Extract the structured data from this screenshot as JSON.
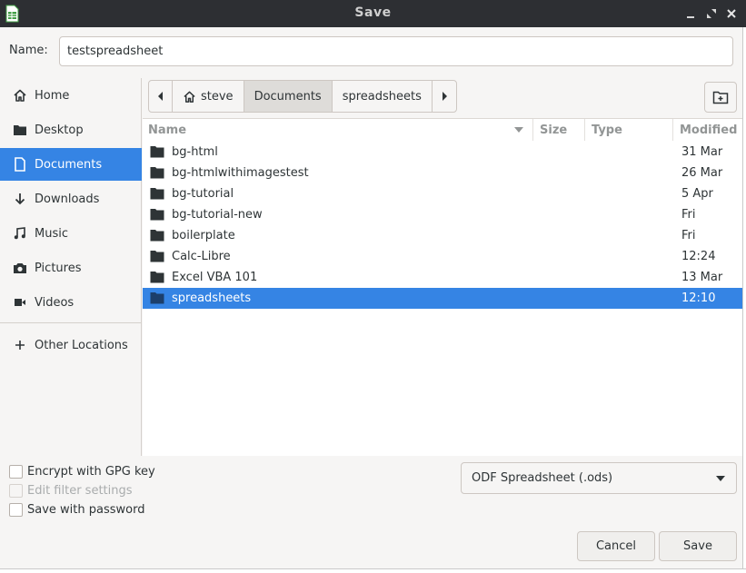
{
  "window": {
    "title": "Save"
  },
  "name_field": {
    "label": "Name:",
    "value": "testspreadsheet"
  },
  "sidebar": {
    "items": [
      {
        "label": "Home",
        "icon": "home-icon"
      },
      {
        "label": "Desktop",
        "icon": "desktop-folder-icon"
      },
      {
        "label": "Documents",
        "icon": "document-icon",
        "selected": true
      },
      {
        "label": "Downloads",
        "icon": "download-arrow-icon"
      },
      {
        "label": "Music",
        "icon": "music-note-icon"
      },
      {
        "label": "Pictures",
        "icon": "camera-icon"
      },
      {
        "label": "Videos",
        "icon": "video-camera-icon"
      }
    ],
    "other_locations": {
      "label": "Other Locations",
      "icon": "plus-icon"
    }
  },
  "pathbar": {
    "crumbs": [
      {
        "label": "steve",
        "icon": "home-icon"
      },
      {
        "label": "Documents",
        "active": true
      },
      {
        "label": "spreadsheets"
      }
    ]
  },
  "filelist": {
    "columns": {
      "name": "Name",
      "size": "Size",
      "type": "Type",
      "modified": "Modified"
    },
    "rows": [
      {
        "name": "bg-html",
        "modified": "31 Mar"
      },
      {
        "name": "bg-htmlwithimagestest",
        "modified": "26 Mar"
      },
      {
        "name": "bg-tutorial",
        "modified": "5 Apr"
      },
      {
        "name": "bg-tutorial-new",
        "modified": "Fri"
      },
      {
        "name": "boilerplate",
        "modified": "Fri"
      },
      {
        "name": "Calc-Libre",
        "modified": "12:24"
      },
      {
        "name": "Excel VBA 101",
        "modified": "13 Mar"
      },
      {
        "name": "spreadsheets",
        "modified": "12:10",
        "selected": true
      }
    ]
  },
  "options": {
    "encrypt": "Encrypt with GPG key",
    "edit_filter": "Edit filter settings",
    "save_password": "Save with password"
  },
  "filetype": {
    "value": "ODF Spreadsheet (.ods)"
  },
  "buttons": {
    "cancel": "Cancel",
    "save": "Save"
  },
  "colors": {
    "accent": "#3584e4",
    "titlebar": "#2d2f33"
  }
}
